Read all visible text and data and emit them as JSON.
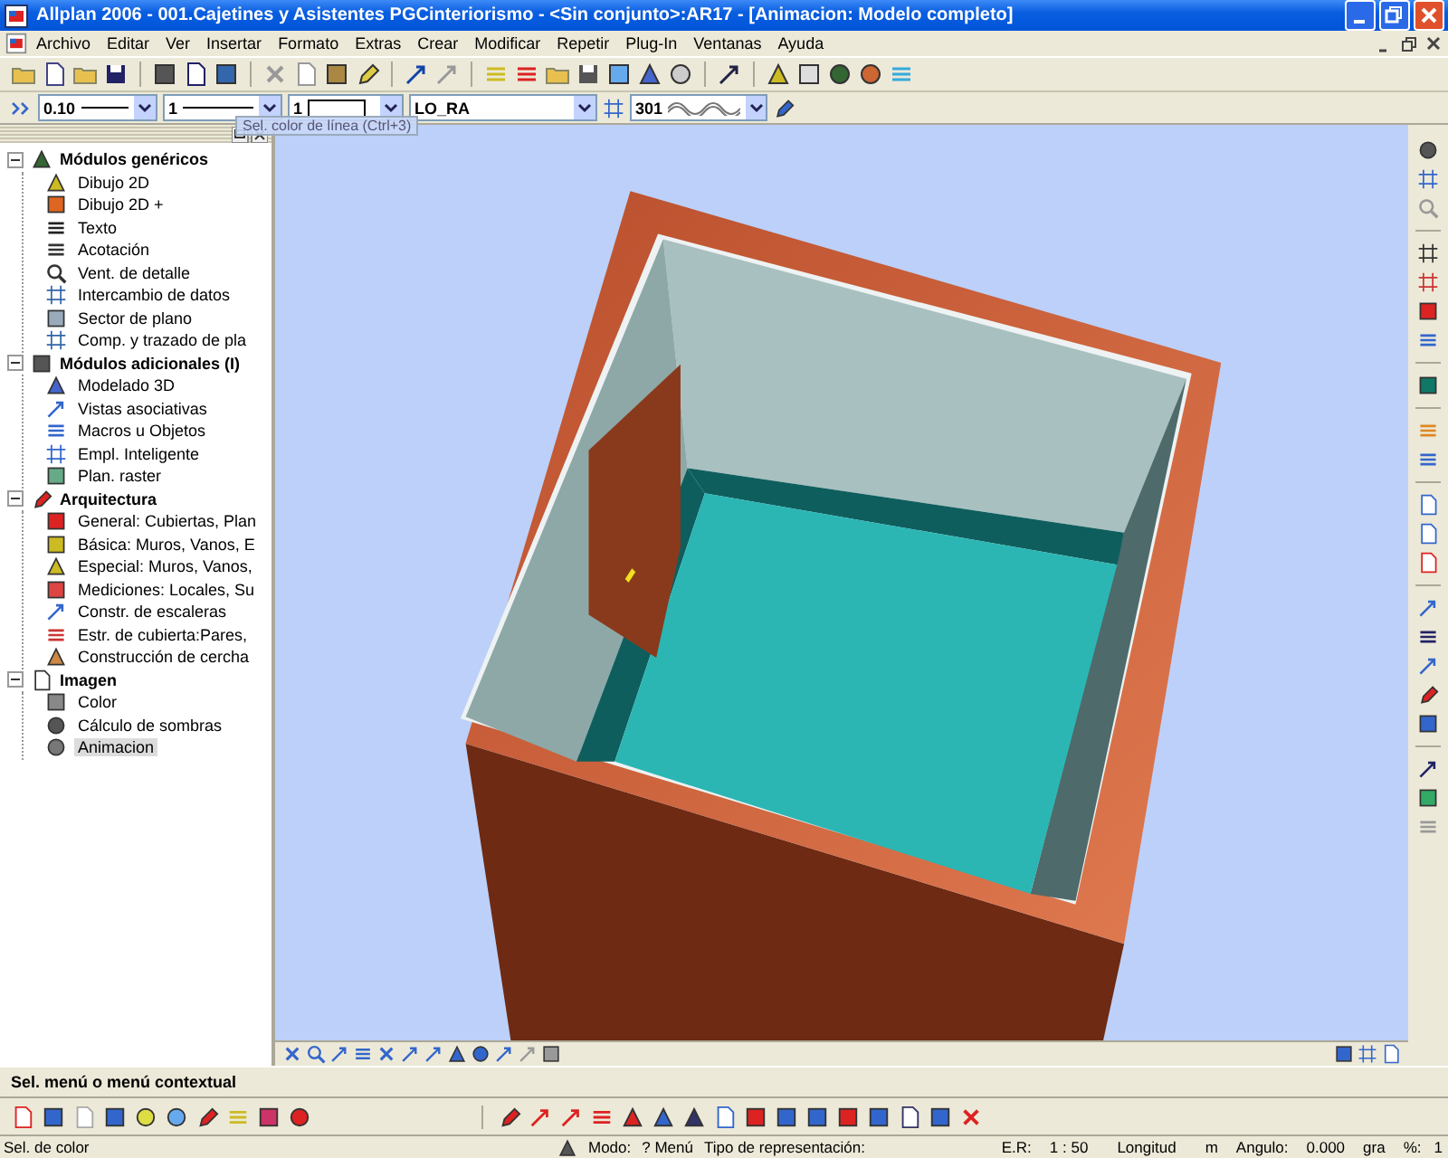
{
  "window": {
    "title": "Allplan 2006 - 001.Cajetines y Asistentes PGCinteriorismo - <Sin conjunto>:AR17 - [Animacion: Modelo completo]"
  },
  "menu": [
    "Archivo",
    "Editar",
    "Ver",
    "Insertar",
    "Formato",
    "Extras",
    "Crear",
    "Modificar",
    "Repetir",
    "Plug-In",
    "Ventanas",
    "Ayuda"
  ],
  "format_fields": [
    {
      "kind": "linewidth",
      "value": "0.10"
    },
    {
      "kind": "linetype",
      "value": "1"
    },
    {
      "kind": "color",
      "value": "1"
    },
    {
      "kind": "layer",
      "value": "LO_RA"
    },
    {
      "kind": "pattern",
      "value": "301"
    }
  ],
  "tooltip": "Sel. color de línea (Ctrl+3)",
  "tree": [
    {
      "label": "Módulos genéricos",
      "expanded": true,
      "children": [
        {
          "label": "Dibujo 2D",
          "selected": false
        },
        {
          "label": "Dibujo 2D +",
          "selected": false
        },
        {
          "label": "Texto",
          "selected": false
        },
        {
          "label": "Acotación",
          "selected": false
        },
        {
          "label": "Vent. de detalle",
          "selected": false
        },
        {
          "label": "Intercambio de datos",
          "selected": false
        },
        {
          "label": "Sector de plano",
          "selected": false
        },
        {
          "label": "Comp. y trazado de pla",
          "selected": false
        }
      ]
    },
    {
      "label": "Módulos adicionales (I)",
      "expanded": true,
      "children": [
        {
          "label": "Modelado 3D",
          "selected": false
        },
        {
          "label": "Vistas asociativas",
          "selected": false
        },
        {
          "label": "Macros u Objetos",
          "selected": false
        },
        {
          "label": "Empl. Inteligente",
          "selected": false
        },
        {
          "label": "Plan. raster",
          "selected": false
        }
      ]
    },
    {
      "label": "Arquitectura",
      "expanded": true,
      "children": [
        {
          "label": "General: Cubiertas, Plan",
          "selected": false
        },
        {
          "label": "Básica: Muros, Vanos, E",
          "selected": false
        },
        {
          "label": "Especial: Muros, Vanos,",
          "selected": false
        },
        {
          "label": "Mediciones: Locales, Su",
          "selected": false
        },
        {
          "label": "Constr. de escaleras",
          "selected": false
        },
        {
          "label": "Estr. de cubierta:Pares,",
          "selected": false
        },
        {
          "label": "Construcción de cercha",
          "selected": false
        }
      ]
    },
    {
      "label": "Imagen",
      "expanded": true,
      "children": [
        {
          "label": "Color",
          "selected": false
        },
        {
          "label": "Cálculo de sombras",
          "selected": false
        },
        {
          "label": "Animacion",
          "selected": true
        }
      ]
    }
  ],
  "prompt": "Sel. menú o menú contextual",
  "status_bar": {
    "hint": "Sel. de color",
    "mode_label": "Modo:",
    "mode": "? Menú",
    "representation_label": "Tipo de representación:",
    "scale_label": "E.R:",
    "scale": "1 : 50",
    "length_label": "Longitud",
    "length_unit": "m",
    "angle_label": "Angulo:",
    "angle": "0.000",
    "angle_unit": "gra",
    "percent_label": "%:",
    "percent": "1"
  }
}
